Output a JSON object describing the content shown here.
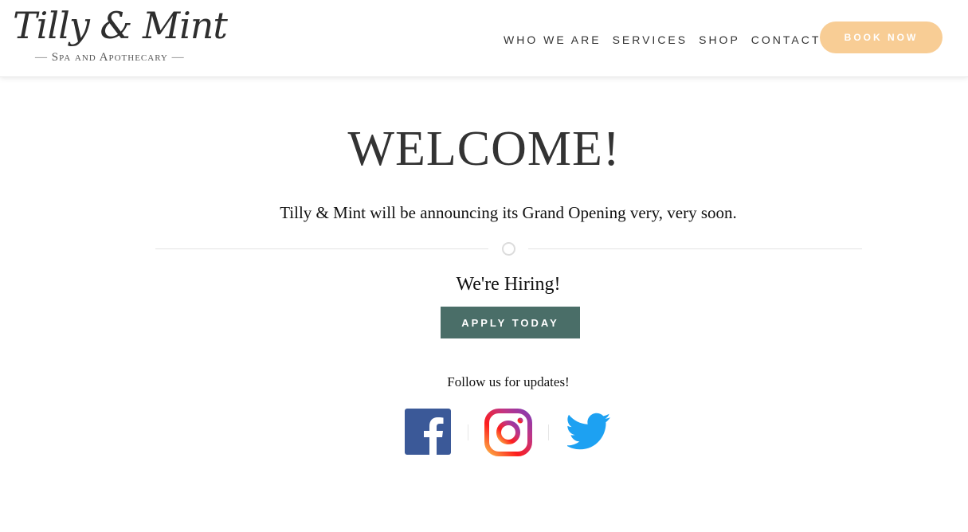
{
  "header": {
    "logo": {
      "main": "Tilly & Mint",
      "sub": "Spa and Apothecary",
      "dash": "—"
    },
    "nav": [
      "WHO WE ARE",
      "SERVICES",
      "SHOP",
      "CONTACT"
    ],
    "book_label": "BOOK NOW"
  },
  "main": {
    "title": "WELCOME!",
    "announcement": "Tilly & Mint will be announcing its Grand Opening very, very soon.",
    "hiring": "We're Hiring!",
    "apply_label": "APPLY TODAY",
    "follow": "Follow us for updates!",
    "social": [
      "facebook-icon",
      "instagram-icon",
      "twitter-icon"
    ]
  },
  "colors": {
    "accent_button": "#f8cd95",
    "apply_button": "#4a6e68",
    "facebook": "#3b5998",
    "twitter": "#1da1f2"
  }
}
